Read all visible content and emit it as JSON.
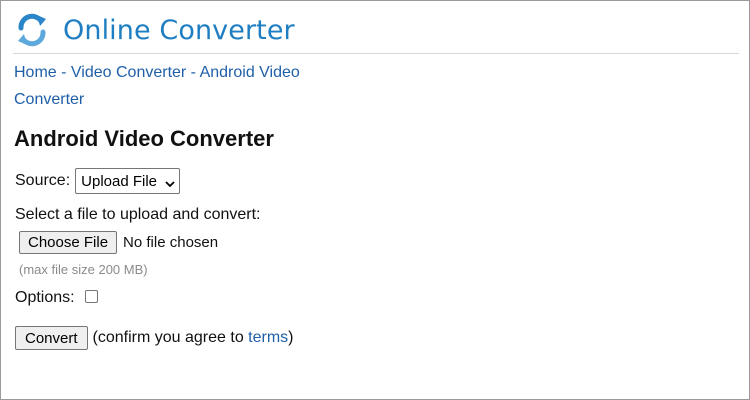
{
  "header": {
    "title": "Online Converter",
    "logo_icon": "sync-arrows-icon",
    "logo_color": "#2a86c8"
  },
  "breadcrumb": {
    "items": [
      "Home",
      "Video Converter",
      "Android Video Converter"
    ],
    "separator": " - "
  },
  "main": {
    "title": "Android Video Converter",
    "source": {
      "label": "Source:",
      "selected": "Upload File"
    },
    "file": {
      "label": "Select a file to upload and convert:",
      "button_label": "Choose File",
      "status": "No file chosen",
      "max_size_note": "(max file size 200 MB)"
    },
    "options": {
      "label": "Options:",
      "checked": false
    },
    "convert": {
      "button_label": "Convert",
      "confirm_prefix": "(confirm you agree to ",
      "terms_link": "terms",
      "confirm_suffix": ")"
    }
  },
  "colors": {
    "link": "#1f5fa8",
    "title": "#1f7ec1",
    "muted": "#8a8a8a"
  }
}
